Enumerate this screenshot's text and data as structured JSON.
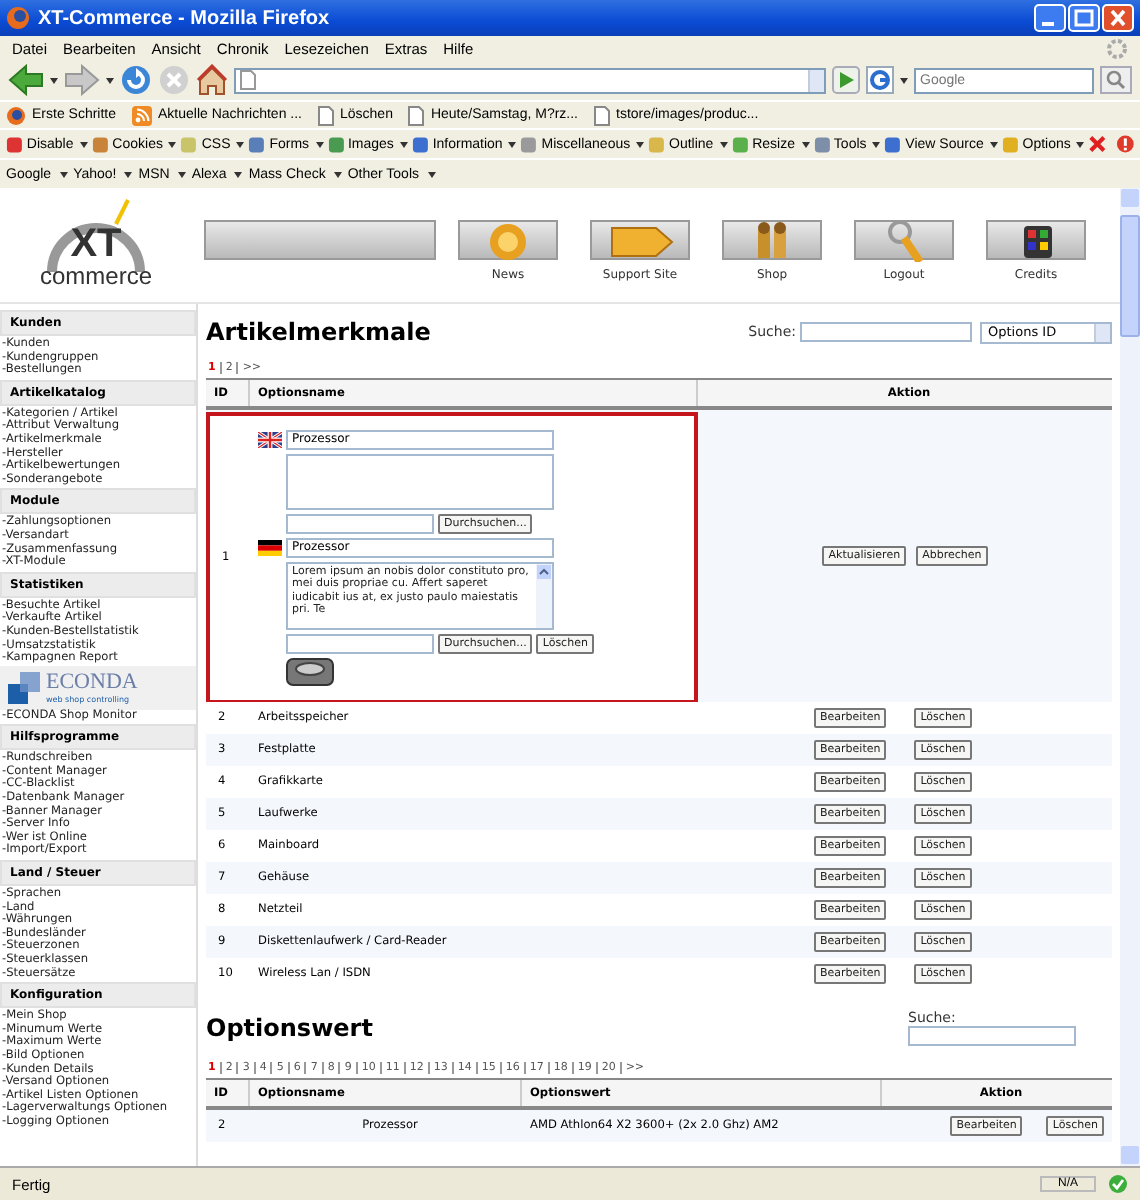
{
  "window": {
    "title": "XT-Commerce - Mozilla Firefox"
  },
  "menu": [
    "Datei",
    "Bearbeiten",
    "Ansicht",
    "Chronik",
    "Lesezeichen",
    "Extras",
    "Hilfe"
  ],
  "navbar": {
    "search_placeholder": "Google"
  },
  "bookmarks": [
    {
      "kind": "firefox",
      "label": "Erste Schritte"
    },
    {
      "kind": "feed",
      "label": "Aktuelle Nachrichten ..."
    },
    {
      "kind": "page",
      "label": "Löschen"
    },
    {
      "kind": "page",
      "label": "Heute/Samstag, M?rz..."
    },
    {
      "kind": "page",
      "label": "tstore/images/produc..."
    }
  ],
  "dev_toolbar": [
    "Disable",
    "Cookies",
    "CSS",
    "Forms",
    "Images",
    "Information",
    "Miscellaneous",
    "Outline",
    "Resize",
    "Tools",
    "View Source",
    "Options"
  ],
  "search_toolbar": [
    "Google",
    "Yahoo!",
    "MSN",
    "Alexa",
    "Mass Check",
    "Other Tools"
  ],
  "logo": {
    "mark": "XT",
    "word": "commerce"
  },
  "header_buttons": [
    "News",
    "Support Site",
    "Shop",
    "Logout",
    "Credits"
  ],
  "sidebar": [
    {
      "title": "Kunden",
      "items": [
        {
          "kind": "link",
          "label": "-Kunden"
        },
        {
          "kind": "link",
          "label": "-Kundengruppen"
        },
        {
          "kind": "link",
          "label": "-Bestellungen"
        }
      ]
    },
    {
      "title": "Artikelkatalog",
      "items": [
        {
          "kind": "link",
          "label": "-Kategorien / Artikel"
        },
        {
          "kind": "link",
          "label": "-Attribut Verwaltung"
        },
        {
          "kind": "link",
          "label": "-Artikelmerkmale"
        },
        {
          "kind": "link",
          "label": "-Hersteller"
        },
        {
          "kind": "link",
          "label": "-Artikelbewertungen"
        },
        {
          "kind": "link",
          "label": "-Sonderangebote"
        }
      ]
    },
    {
      "title": "Module",
      "items": [
        {
          "kind": "link",
          "label": "-Zahlungsoptionen"
        },
        {
          "kind": "link",
          "label": "-Versandart"
        },
        {
          "kind": "link",
          "label": "-Zusammenfassung"
        },
        {
          "kind": "link",
          "label": "-XT-Module"
        }
      ]
    },
    {
      "title": "Statistiken",
      "items": [
        {
          "kind": "link",
          "label": "-Besuchte Artikel"
        },
        {
          "kind": "link",
          "label": "-Verkaufte Artikel"
        },
        {
          "kind": "link",
          "label": "-Kunden-Bestellstatistik"
        },
        {
          "kind": "link",
          "label": "-Umsatzstatistik"
        },
        {
          "kind": "link",
          "label": "-Kampagnen Report"
        },
        {
          "kind": "banner",
          "label": "ECONDA",
          "subtitle": "web shop controlling"
        },
        {
          "kind": "link",
          "label": "-ECONDA Shop Monitor"
        }
      ]
    },
    {
      "title": "Hilfsprogramme",
      "items": [
        {
          "kind": "link",
          "label": "-Rundschreiben"
        },
        {
          "kind": "link",
          "label": "-Content Manager"
        },
        {
          "kind": "link",
          "label": "-CC-Blacklist"
        },
        {
          "kind": "link",
          "label": "-Datenbank Manager"
        },
        {
          "kind": "link",
          "label": "-Banner Manager"
        },
        {
          "kind": "link",
          "label": "-Server Info"
        },
        {
          "kind": "link",
          "label": "-Wer ist Online"
        },
        {
          "kind": "link",
          "label": "-Import/Export"
        }
      ]
    },
    {
      "title": "Land / Steuer",
      "items": [
        {
          "kind": "link",
          "label": "-Sprachen"
        },
        {
          "kind": "link",
          "label": "-Land"
        },
        {
          "kind": "link",
          "label": "-Währungen"
        },
        {
          "kind": "link",
          "label": "-Bundesländer"
        },
        {
          "kind": "link",
          "label": "-Steuerzonen"
        },
        {
          "kind": "link",
          "label": "-Steuerklassen"
        },
        {
          "kind": "link",
          "label": "-Steuersätze"
        }
      ]
    },
    {
      "title": "Konfiguration",
      "items": [
        {
          "kind": "link",
          "label": "-Mein Shop"
        },
        {
          "kind": "link",
          "label": "-Minumum Werte"
        },
        {
          "kind": "link",
          "label": "-Maximum Werte"
        },
        {
          "kind": "link",
          "label": "-Bild Optionen"
        },
        {
          "kind": "link",
          "label": "-Kunden Details"
        },
        {
          "kind": "link",
          "label": "-Versand Optionen"
        },
        {
          "kind": "link",
          "label": "-Artikel Listen Optionen"
        },
        {
          "kind": "link",
          "label": "-Lagerverwaltungs Optionen"
        },
        {
          "kind": "link",
          "label": "-Logging Optionen"
        }
      ]
    }
  ],
  "features": {
    "title": "Artikelmerkmale",
    "search_label": "Suche:",
    "search_by": "Options ID",
    "pager": [
      {
        "label": "1",
        "selected": true
      },
      {
        "label": "2",
        "selected": false
      },
      {
        "label": ">>",
        "selected": false
      }
    ],
    "columns": [
      "ID",
      "Optionsname",
      "Aktion"
    ],
    "rows": [
      {
        "kind": "edit",
        "id": "1",
        "languages": [
          {
            "kind": "en",
            "name": "Prozessor",
            "browse_button": "Durchsuchen..."
          },
          {
            "kind": "de",
            "name": "Prozessor",
            "description": "Lorem ipsum an nobis dolor constituto pro, mei duis propriae cu. Affert saperet iudicabit ius at, ex justo paulo maiestatis pri. Te",
            "browse_button": "Durchsuchen...",
            "delete_button": "Löschen"
          }
        ],
        "actions": [
          "Aktualisieren",
          "Abbrechen"
        ]
      },
      {
        "kind": "view",
        "id": "2",
        "name": "Arbeitsspeicher",
        "actions": [
          "Bearbeiten",
          "Löschen"
        ]
      },
      {
        "kind": "view",
        "id": "3",
        "name": "Festplatte",
        "actions": [
          "Bearbeiten",
          "Löschen"
        ]
      },
      {
        "kind": "view",
        "id": "4",
        "name": "Grafikkarte",
        "actions": [
          "Bearbeiten",
          "Löschen"
        ]
      },
      {
        "kind": "view",
        "id": "5",
        "name": "Laufwerke",
        "actions": [
          "Bearbeiten",
          "Löschen"
        ]
      },
      {
        "kind": "view",
        "id": "6",
        "name": "Mainboard",
        "actions": [
          "Bearbeiten",
          "Löschen"
        ]
      },
      {
        "kind": "view",
        "id": "7",
        "name": "Gehäuse",
        "actions": [
          "Bearbeiten",
          "Löschen"
        ]
      },
      {
        "kind": "view",
        "id": "8",
        "name": "Netzteil",
        "actions": [
          "Bearbeiten",
          "Löschen"
        ]
      },
      {
        "kind": "view",
        "id": "9",
        "name": "Diskettenlaufwerk / Card-Reader",
        "actions": [
          "Bearbeiten",
          "Löschen"
        ]
      },
      {
        "kind": "view",
        "id": "10",
        "name": "Wireless Lan / ISDN",
        "actions": [
          "Bearbeiten",
          "Löschen"
        ]
      }
    ]
  },
  "values": {
    "title": "Optionswert",
    "search_label": "Suche:",
    "pager": [
      {
        "label": "1",
        "selected": true
      },
      {
        "label": "2",
        "selected": false
      },
      {
        "label": "3",
        "selected": false
      },
      {
        "label": "4",
        "selected": false
      },
      {
        "label": "5",
        "selected": false
      },
      {
        "label": "6",
        "selected": false
      },
      {
        "label": "7",
        "selected": false
      },
      {
        "label": "8",
        "selected": false
      },
      {
        "label": "9",
        "selected": false
      },
      {
        "label": "10",
        "selected": false
      },
      {
        "label": "11",
        "selected": false
      },
      {
        "label": "12",
        "selected": false
      },
      {
        "label": "13",
        "selected": false
      },
      {
        "label": "14",
        "selected": false
      },
      {
        "label": "15",
        "selected": false
      },
      {
        "label": "16",
        "selected": false
      },
      {
        "label": "17",
        "selected": false
      },
      {
        "label": "18",
        "selected": false
      },
      {
        "label": "19",
        "selected": false
      },
      {
        "label": "20",
        "selected": false
      },
      {
        "label": ">>",
        "selected": false
      }
    ],
    "columns": [
      "ID",
      "Optionsname",
      "Optionswert",
      "Aktion"
    ],
    "rows": [
      {
        "id": "2",
        "name": "Prozessor",
        "value": "AMD Athlon64 X2 3600+ (2x 2.0 Ghz) AM2",
        "actions": [
          "Bearbeiten",
          "Löschen"
        ]
      }
    ]
  },
  "status_bar": {
    "text": "Fertig",
    "zone": "N/A"
  }
}
